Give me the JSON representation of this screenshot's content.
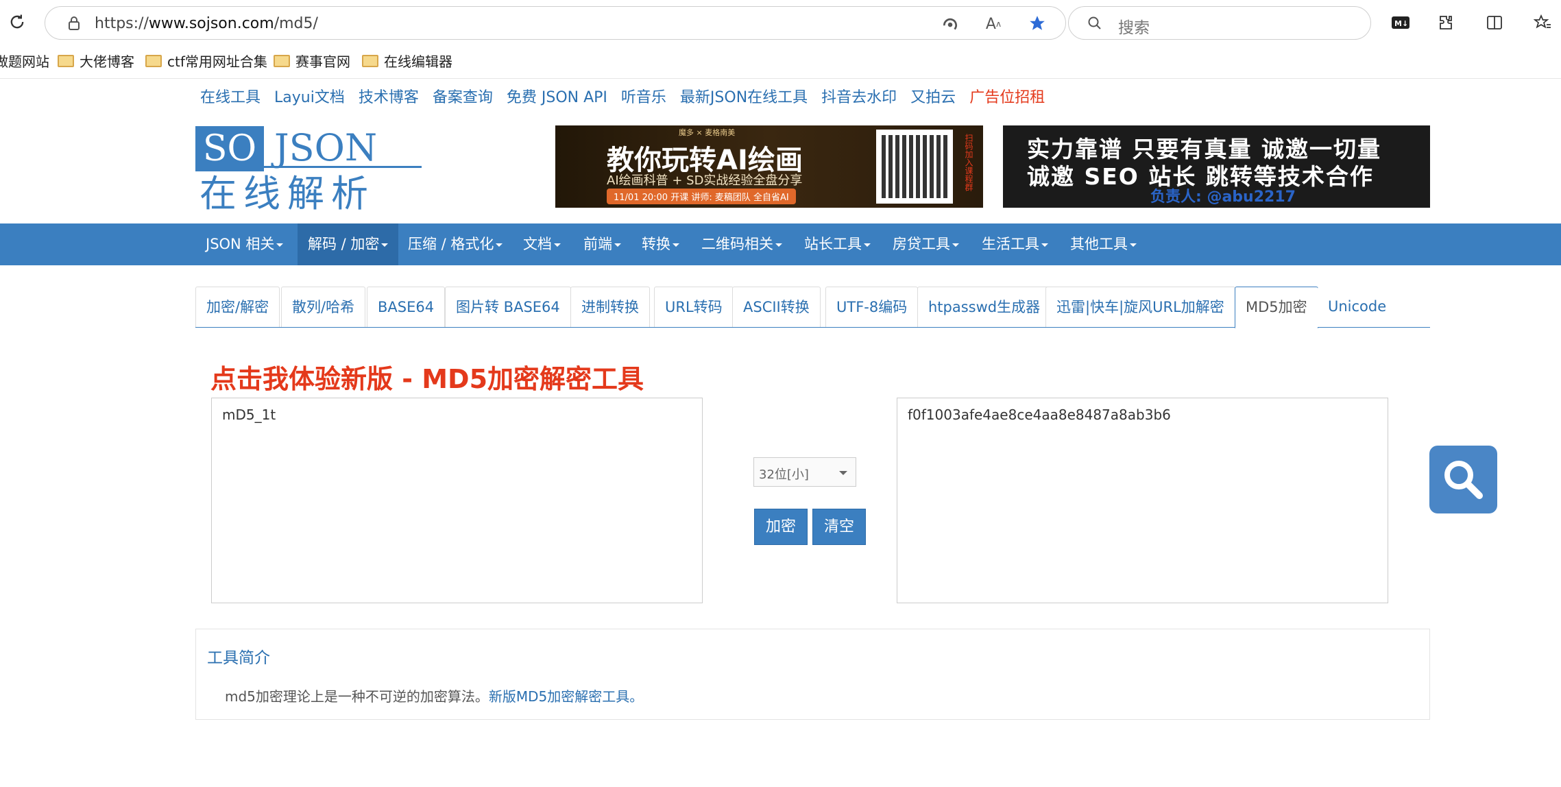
{
  "browser": {
    "url_prefix": "https://",
    "url_host": "www.sojson.com",
    "url_path": "/md5/",
    "search_placeholder": "搜索",
    "bookmarks": [
      "做题网站",
      "大佬博客",
      "ctf常用网址合集",
      "赛事官网",
      "在线编辑器"
    ]
  },
  "toplinks": [
    "在线工具",
    "Layui文档",
    "技术博客",
    "备案查询",
    "免费 JSON API",
    "听音乐",
    "最新JSON在线工具",
    "抖音去水印",
    "又拍云"
  ],
  "toplink_ad": "广告位招租",
  "logo": {
    "so": "SO",
    "json": "JSON",
    "sub": "在线解析"
  },
  "ad1": {
    "brand": "魔多 × 麦格南美",
    "headline": "教你玩转AI绘画",
    "sub": "AI绘画科普 + SD实战经验全盘分享",
    "tag": "11/01 20:00 开课   讲师: 麦稿团队 全自省AI",
    "side": "扫码加入课程群"
  },
  "ad2": {
    "line1": "实力靠谱 只要有真量 诚邀一切量",
    "line2": "诚邀 SEO 站长 跳转等技术合作",
    "line3": "负责人: @abu2217"
  },
  "nav": [
    "JSON 相关",
    "解码 / 加密",
    "压缩 / 格式化",
    "文档",
    "前端",
    "转换",
    "二维码相关",
    "站长工具",
    "房贷工具",
    "生活工具",
    "其他工具"
  ],
  "tabs": [
    "加密/解密",
    "散列/哈希",
    "BASE64",
    "图片转 BASE64",
    "进制转换",
    "URL转码",
    "ASCII转换",
    "UTF-8编码",
    "htpasswd生成器",
    "迅雷|快车|旋风URL加解密",
    "MD5加密",
    "Unicode"
  ],
  "promo": "点击我体验新版 - MD5加密解密工具",
  "input_value": "mD5_1t",
  "output_value": "f0f1003afe4ae8ce4aa8e8487a8ab3b6",
  "select_value": "32位[小]",
  "encrypt_label": "加密",
  "clear_label": "清空",
  "intro": {
    "title": "工具简介",
    "text": "md5加密理论上是一种不可逆的加密算法。",
    "link": "新版MD5加密解密工具。"
  },
  "colors": {
    "accent": "#3b7fc0",
    "red": "#e4391b",
    "link": "#2a6fb0"
  }
}
